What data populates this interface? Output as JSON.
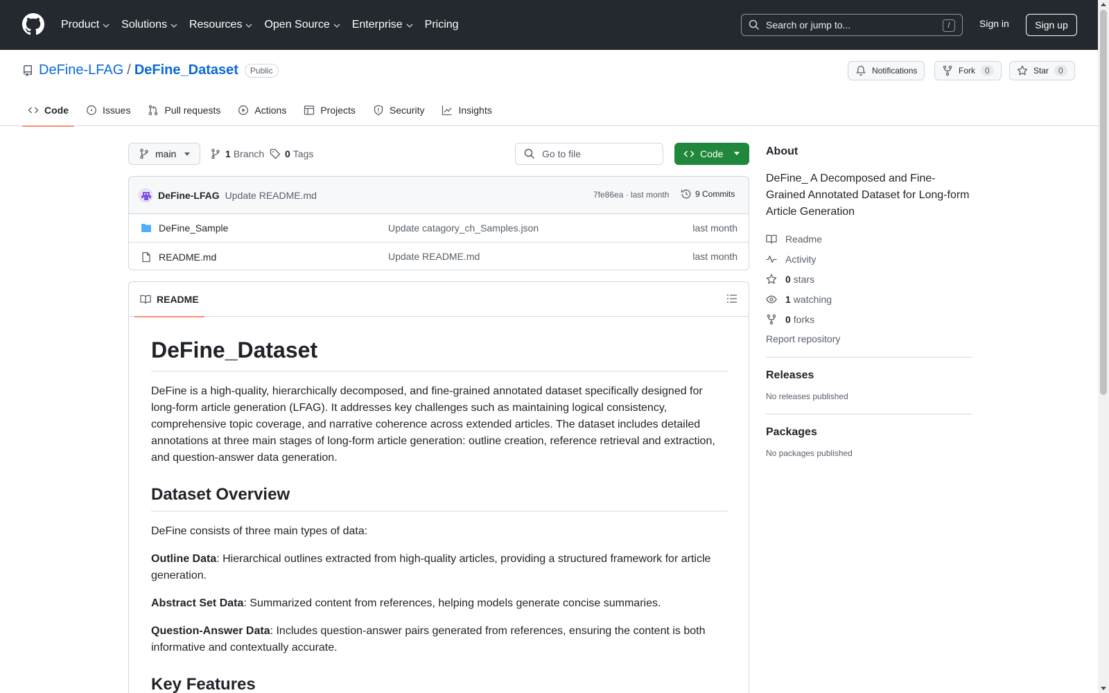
{
  "header": {
    "nav": [
      {
        "label": "Product"
      },
      {
        "label": "Solutions"
      },
      {
        "label": "Resources"
      },
      {
        "label": "Open Source"
      },
      {
        "label": "Enterprise"
      },
      {
        "label": "Pricing"
      }
    ],
    "search_placeholder": "Search or jump to...",
    "search_shortcut": "/",
    "sign_in": "Sign in",
    "sign_up": "Sign up"
  },
  "repo": {
    "owner": "DeFine-LFAG",
    "separator": "/",
    "name": "DeFine_Dataset",
    "visibility": "Public",
    "notifications": "Notifications",
    "fork_label": "Fork",
    "fork_count": "0",
    "star_label": "Star",
    "star_count": "0",
    "tabs": [
      {
        "label": "Code",
        "icon": "code-icon",
        "active": true
      },
      {
        "label": "Issues",
        "icon": "issue-icon"
      },
      {
        "label": "Pull requests",
        "icon": "pull-request-icon"
      },
      {
        "label": "Actions",
        "icon": "play-icon"
      },
      {
        "label": "Projects",
        "icon": "table-icon"
      },
      {
        "label": "Security",
        "icon": "shield-icon"
      },
      {
        "label": "Insights",
        "icon": "graph-icon"
      }
    ]
  },
  "branch": {
    "current": "main",
    "branch_count": "1",
    "branch_label": "Branch",
    "tag_count": "0",
    "tag_label": "Tags"
  },
  "goto_placeholder": "Go to file",
  "code_button": "Code",
  "commit": {
    "author": "DeFine-LFAG",
    "message": "Update README.md",
    "hash_time": "7fe86ea · last month",
    "count": "9 Commits"
  },
  "files": [
    {
      "type": "folder",
      "name": "DeFine_Sample",
      "message": "Update catagory_ch_Samples.json",
      "time": "last month"
    },
    {
      "type": "file",
      "name": "README.md",
      "message": "Update README.md",
      "time": "last month"
    }
  ],
  "readme": {
    "tab": "README",
    "title": "DeFine_Dataset",
    "intro": "DeFine is a high-quality, hierarchically decomposed, and fine-grained annotated dataset specifically designed for long-form article generation (LFAG). It addresses key challenges such as maintaining logical consistency, comprehensive topic coverage, and narrative coherence across extended articles. The dataset includes detailed annotations at three main stages of long-form article generation: outline creation, reference retrieval and extraction, and question-answer data generation.",
    "h_overview": "Dataset Overview",
    "overview_intro": "DeFine consists of three main types of data:",
    "outline_term": "Outline Data",
    "outline_desc": ": Hierarchical outlines extracted from high-quality articles, providing a structured framework for article generation.",
    "abstract_term": "Abstract Set Data",
    "abstract_desc": ": Summarized content from references, helping models generate concise summaries.",
    "qa_term": "Question-Answer Data",
    "qa_desc": ": Includes question-answer pairs generated from references, ensuring the content is both informative and contextually accurate.",
    "h_features": "Key Features"
  },
  "sidebar": {
    "about_title": "About",
    "about_desc": "DeFine_ A Decomposed and Fine-Grained Annotated Dataset for Long-form Article Generation",
    "readme": "Readme",
    "activity": "Activity",
    "stars_count": "0",
    "stars_label": "stars",
    "watching_count": "1",
    "watching_label": "watching",
    "forks_count": "0",
    "forks_label": "forks",
    "report": "Report repository",
    "releases_title": "Releases",
    "releases_none": "No releases published",
    "packages_title": "Packages",
    "packages_none": "No packages published"
  },
  "colors": {
    "header_bg": "#24292f",
    "link": "#0969da",
    "primary_button": "#1f883d",
    "active_tab_underline": "#fd8c73",
    "folder": "#54aeff"
  }
}
